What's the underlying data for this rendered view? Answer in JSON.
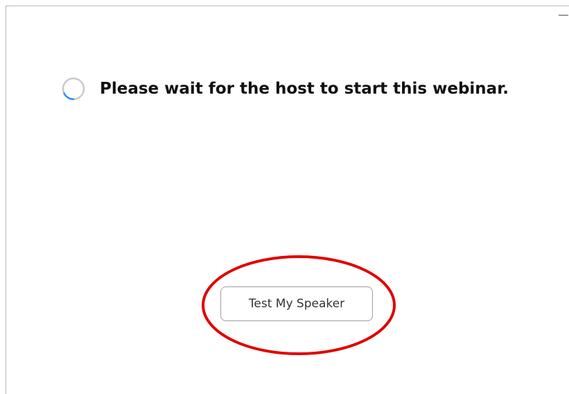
{
  "window": {
    "minimize_icon": "minimize-icon",
    "close_icon": "close-icon",
    "close_glyph": "×"
  },
  "waiting": {
    "message": "Please wait for the host to start this webinar.",
    "spinner_icon": "loading-spinner-icon",
    "spinner_color": "#2d8cff"
  },
  "actions": {
    "test_speaker_label": "Test My Speaker"
  },
  "annotation": {
    "shape": "ellipse",
    "color": "#e00000"
  }
}
